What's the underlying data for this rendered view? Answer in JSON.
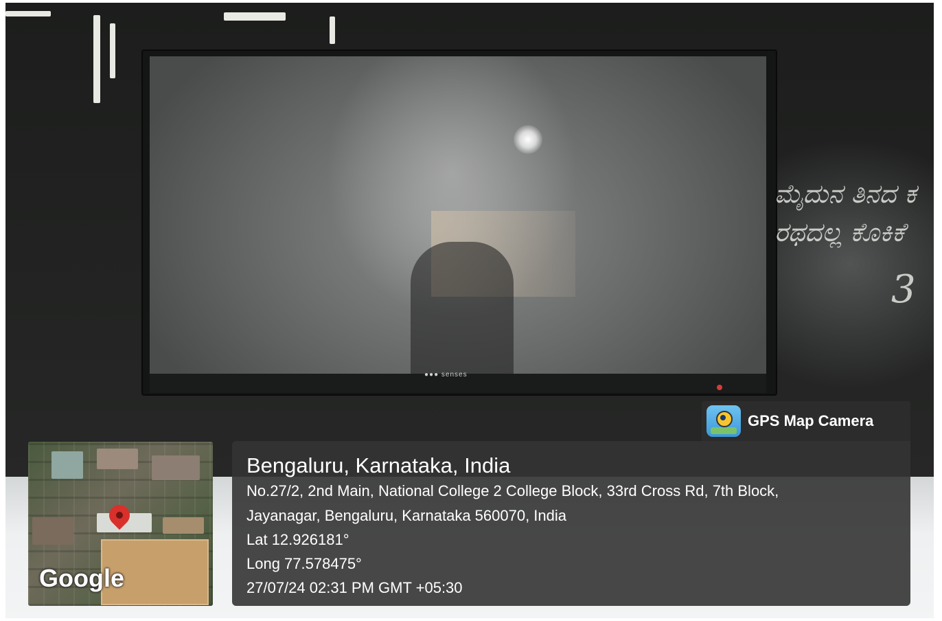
{
  "tv": {
    "brand": "senses"
  },
  "handwriting": {
    "line1": "ಮೈದುನ ತಿನದ ಕ",
    "line2": "ರಥದಲ್ಲ ಕೊಕಿಕೆ",
    "numeral": "3"
  },
  "map": {
    "watermark": "Google"
  },
  "app": {
    "name": "GPS Map Camera"
  },
  "location": {
    "place": "Bengaluru, Karnataka, India",
    "address_line1": "No.27/2, 2nd Main, National College 2 College Block, 33rd Cross Rd, 7th Block,",
    "address_line2": "Jayanagar, Bengaluru, Karnataka 560070, India",
    "lat": "Lat 12.926181°",
    "long": "Long 77.578475°",
    "datetime": "27/07/24 02:31 PM GMT +05:30"
  },
  "colors": {
    "overlay": "#343434",
    "pin": "#d9302c",
    "ground": "#c79f6b"
  }
}
